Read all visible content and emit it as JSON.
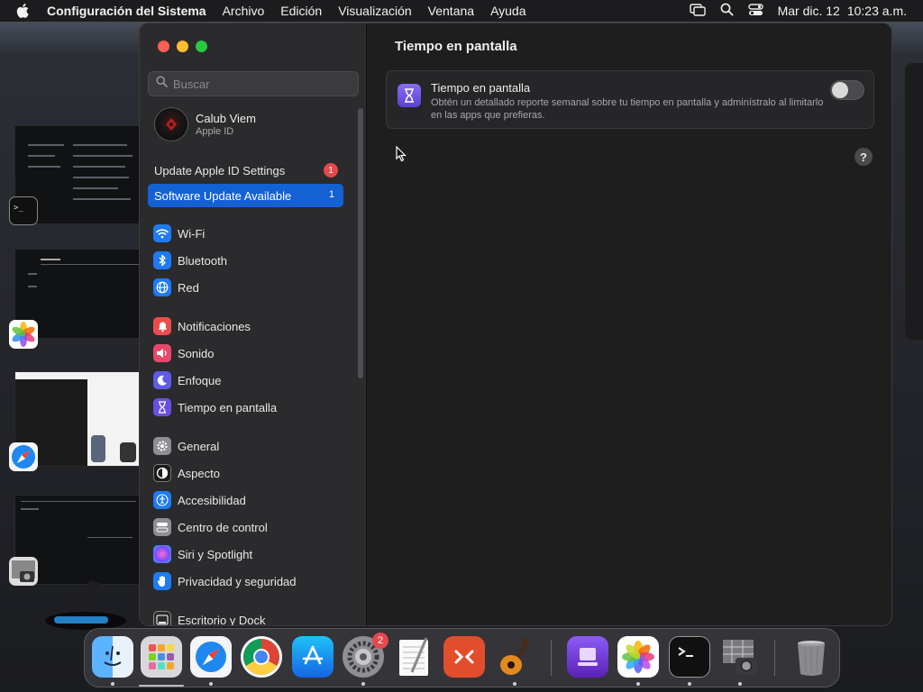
{
  "menubar": {
    "app_name": "Configuración del Sistema",
    "items": [
      "Archivo",
      "Edición",
      "Visualización",
      "Ventana",
      "Ayuda"
    ],
    "date": "Mar dic. 12",
    "time": "10:23 a.m."
  },
  "sidebar": {
    "search_placeholder": "Buscar",
    "profile": {
      "name": "Calub Viem",
      "subtitle": "Apple ID"
    },
    "notices": [
      {
        "label": "Update Apple ID Settings",
        "badge": "1"
      },
      {
        "label": "Software Update Available",
        "count": "1"
      }
    ],
    "groups": [
      [
        {
          "label": "Wi-Fi",
          "icon": "wifi-icon",
          "color": "#1e7bf2"
        },
        {
          "label": "Bluetooth",
          "icon": "bluetooth-icon",
          "color": "#1e7bf2"
        },
        {
          "label": "Red",
          "icon": "globe-icon",
          "color": "#1e7bf2"
        }
      ],
      [
        {
          "label": "Notificaciones",
          "icon": "bell-icon",
          "color": "#eb4d4d"
        },
        {
          "label": "Sonido",
          "icon": "speaker-icon",
          "color": "#e8496a"
        },
        {
          "label": "Enfoque",
          "icon": "moon-icon",
          "color": "#5e5ce6"
        },
        {
          "label": "Tiempo en pantalla",
          "icon": "hourglass-icon",
          "color": "#6a4fe0"
        }
      ],
      [
        {
          "label": "General",
          "icon": "gear-icon",
          "color": "#8e8e93"
        },
        {
          "label": "Aspecto",
          "icon": "appearance-icon",
          "color": "#1c1c1e"
        },
        {
          "label": "Accesibilidad",
          "icon": "accessibility-icon",
          "color": "#1e7bf2"
        },
        {
          "label": "Centro de control",
          "icon": "control-center-icon",
          "color": "#8e8e93"
        },
        {
          "label": "Siri y Spotlight",
          "icon": "siri-icon",
          "color": "#b548d6"
        },
        {
          "label": "Privacidad y seguridad",
          "icon": "hand-icon",
          "color": "#1e7bf2"
        }
      ],
      [
        {
          "label": "Escritorio y Dock",
          "icon": "dock-icon",
          "color": "#2c2c2e"
        }
      ]
    ]
  },
  "content": {
    "title": "Tiempo en pantalla",
    "card": {
      "title": "Tiempo en pantalla",
      "description": "Obtén un detallado reporte semanal sobre tu tiempo en pantalla y adminístralo al limitarlo en las apps que prefieras.",
      "toggle_on": false
    },
    "help_label": "?"
  },
  "dock": {
    "apps": [
      "finder-icon",
      "launchpad-icon",
      "safari-icon",
      "chrome-icon",
      "app-store-icon",
      "system-settings-icon",
      "textedit-icon",
      "remote-desktop-icon",
      "garageband-icon",
      "apple-configurator-icon",
      "photos-icon",
      "terminal-icon",
      "screenshot-icon",
      "trash-icon"
    ],
    "settings_badge": "2"
  }
}
